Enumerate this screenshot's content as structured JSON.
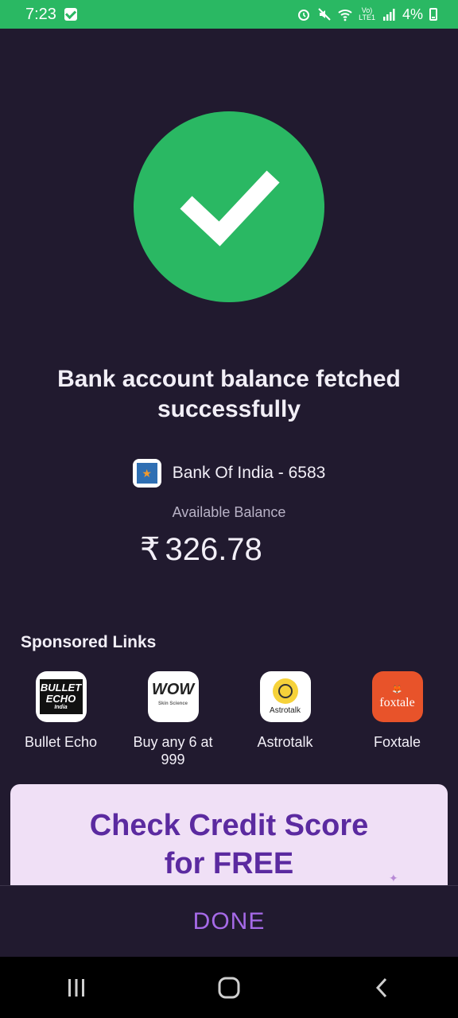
{
  "status_bar": {
    "time": "7:23",
    "network_top": "Vo)",
    "network_bottom": "LTE1",
    "battery": "4%"
  },
  "result": {
    "title": "Bank account balance fetched successfully",
    "bank_name": "Bank Of India - 6583",
    "available_label": "Available Balance",
    "currency_symbol": "₹",
    "amount": "326.78"
  },
  "sponsored": {
    "heading": "Sponsored Links",
    "items": [
      {
        "label": "Bullet Echo",
        "logo_line1": "BULLET",
        "logo_line2": "ECHO",
        "logo_line3": "India",
        "icon": "bullet-echo-logo"
      },
      {
        "label": "Buy any 6 at 999",
        "logo_line1": "WOW",
        "logo_line2": "Skin Science",
        "icon": "wow-logo"
      },
      {
        "label": "Astrotalk",
        "logo_line1": "Astrotalk",
        "icon": "astrotalk-logo"
      },
      {
        "label": "Foxtale",
        "logo_line1": "foxtale",
        "icon": "foxtale-logo"
      }
    ]
  },
  "promo": {
    "line1": "Check Credit Score",
    "line2": "for FREE"
  },
  "actions": {
    "done_label": "DONE"
  },
  "colors": {
    "background": "#211a2f",
    "success_green": "#2ab863",
    "accent_purple": "#a66ae8",
    "promo_bg": "#f0e0f6",
    "promo_text": "#5b2aa0"
  }
}
